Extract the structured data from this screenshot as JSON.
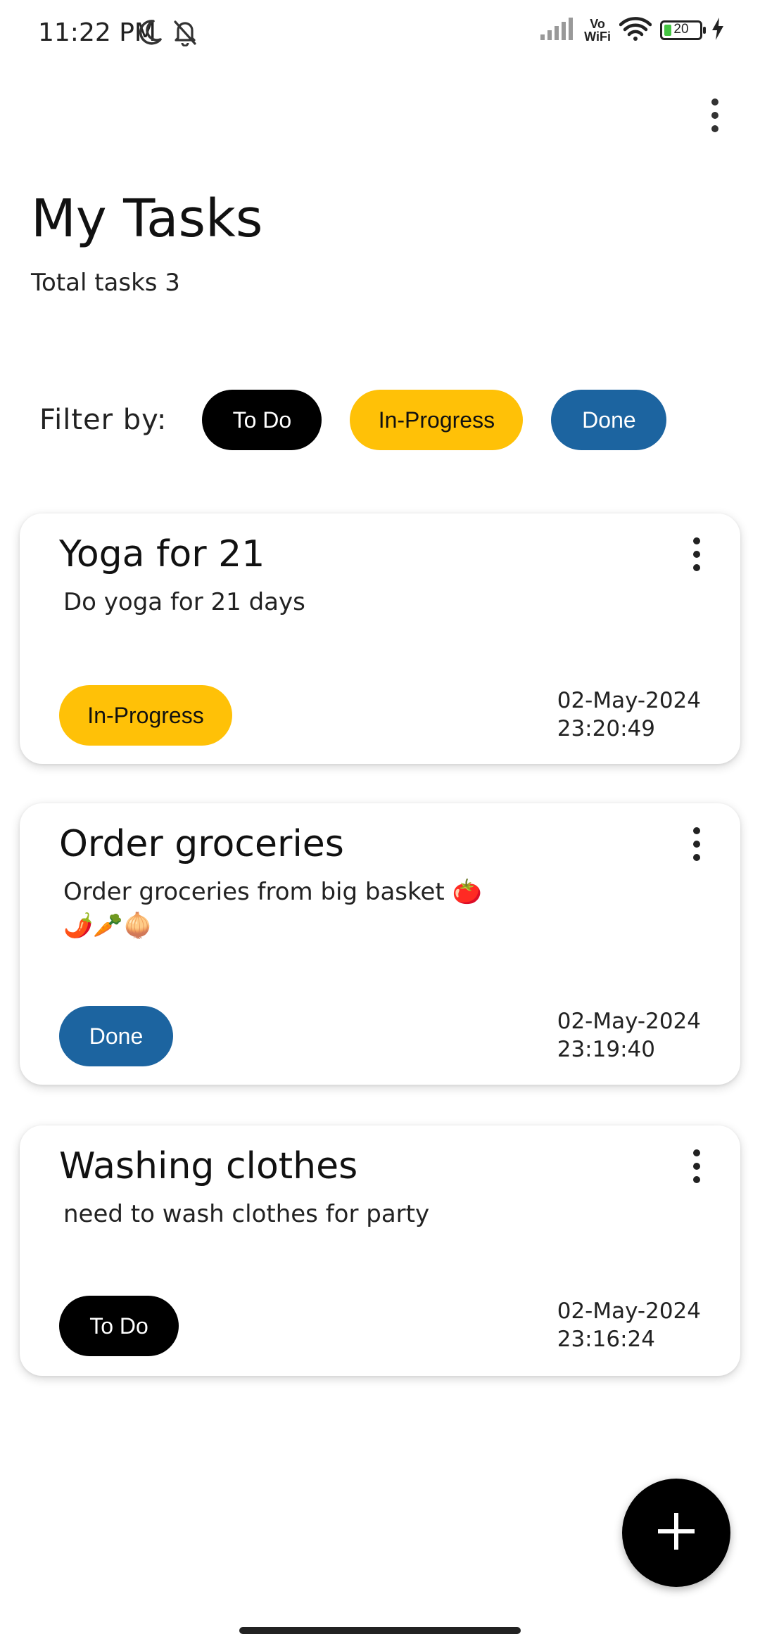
{
  "status_bar": {
    "time": "11:22 PM",
    "vowifi_top": "Vo",
    "vowifi_bottom": "WiFi",
    "battery": "20",
    "icons": [
      "moon-icon",
      "bell-off-icon",
      "signal-icon",
      "wifi-icon",
      "battery-icon",
      "charging-icon"
    ]
  },
  "header": {
    "title": "My Tasks",
    "total_tasks": "Total tasks 3",
    "menu_icon": "more-vertical-icon"
  },
  "filter": {
    "label": "Filter by:",
    "chips": {
      "todo": "To Do",
      "in_progress": "In-Progress",
      "done": "Done"
    }
  },
  "tasks": [
    {
      "title": "Yoga for 21",
      "description": "Do yoga for 21 days",
      "status": "In-Progress",
      "date": "02-May-2024",
      "time": "23:20:49"
    },
    {
      "title": "Order groceries",
      "description": "Order groceries from big basket 🍅",
      "description_line2": "🌶️🥕🧅",
      "status": "Done",
      "date": "02-May-2024",
      "time": "23:19:40"
    },
    {
      "title": "Washing clothes",
      "description": "need to wash clothes for party",
      "status": "To Do",
      "date": "02-May-2024",
      "time": "23:16:24"
    }
  ],
  "fab": {
    "icon": "plus-icon"
  },
  "colors": {
    "todo": "#000000",
    "in_progress": "#ffc107",
    "done": "#1c64a0",
    "battery_fill": "#44c542"
  }
}
